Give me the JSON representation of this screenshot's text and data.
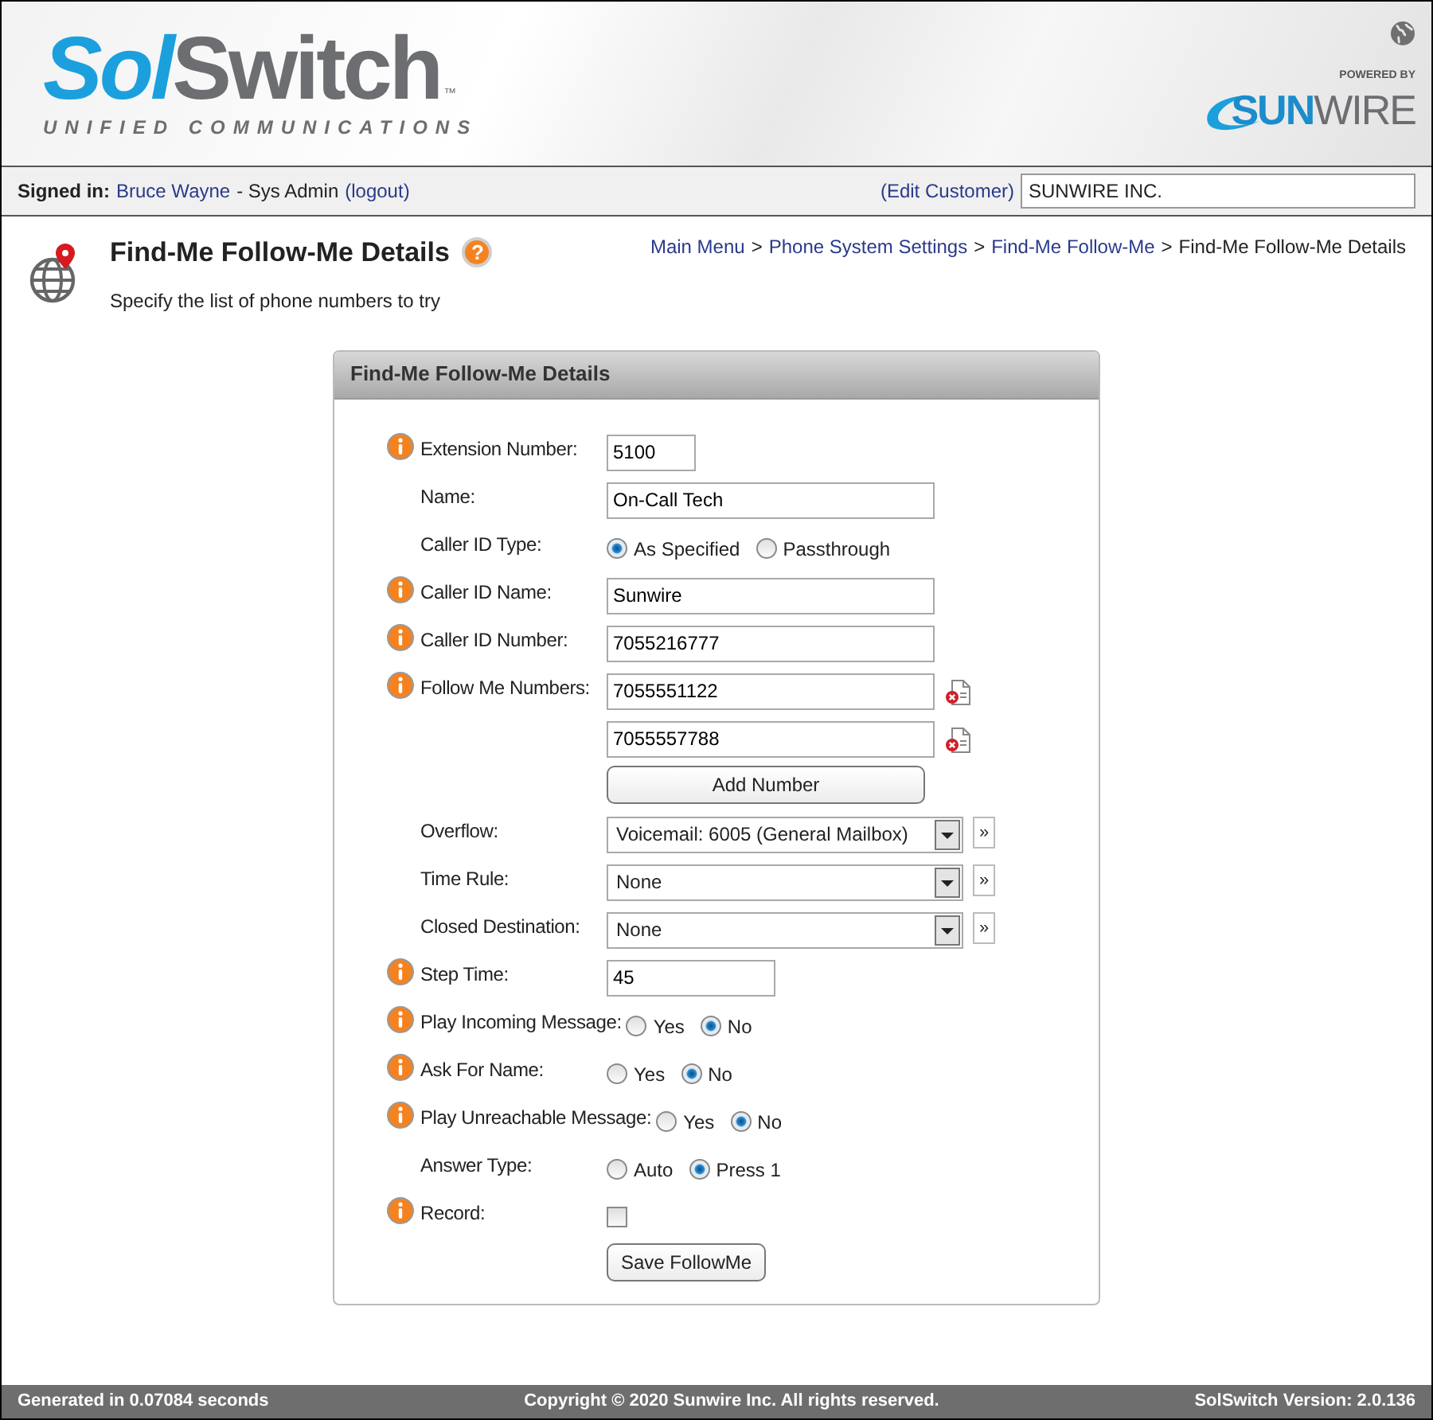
{
  "header": {
    "logo": {
      "part_1": "Sol",
      "part_2": "Switch",
      "trademark": "™",
      "tagline": "UNIFIED COMMUNICATIONS"
    },
    "partner_logo": {
      "caption": "POWERED BY",
      "part_1": "SUN",
      "part_2": "WIRE"
    }
  },
  "user_bar": {
    "label": "Signed in:",
    "user": "Bruce Wayne",
    "role": "- Sys Admin",
    "logout": "(logout)",
    "edit_customer": "(Edit Customer)",
    "customer_value": "SUNWIRE INC."
  },
  "page": {
    "title": "Find-Me Follow-Me Details",
    "help": "?",
    "subtitle": "Specify the list of phone numbers to try",
    "breadcrumb": [
      {
        "label": "Main Menu",
        "link": true
      },
      {
        "label": "Phone System Settings",
        "link": true
      },
      {
        "label": "Find-Me Follow-Me",
        "link": true
      },
      {
        "label": "Find-Me Follow-Me Details",
        "link": false
      }
    ],
    "separator": ">"
  },
  "panel": {
    "title": "Find-Me Follow-Me Details",
    "rows": [
      {
        "kind": "short_text",
        "label": "Extension Number:",
        "info": true,
        "values": [
          "5100"
        ]
      },
      {
        "kind": "text",
        "label": "Name:",
        "info": false,
        "values": [
          "On-Call Tech"
        ]
      },
      {
        "kind": "radio",
        "label": "Caller ID Type:",
        "info": false,
        "options": [
          {
            "label": "As Specified",
            "selected": true
          },
          {
            "label": "Passthrough",
            "selected": false
          }
        ]
      },
      {
        "kind": "text",
        "label": "Caller ID Name:",
        "info": true,
        "values": [
          "Sunwire"
        ]
      },
      {
        "kind": "text",
        "label": "Caller ID Number:",
        "info": true,
        "values": [
          "7055216777"
        ]
      },
      {
        "kind": "numbers",
        "label": "Follow Me Numbers:",
        "info": true,
        "values": [
          "7055551122",
          "7055557788"
        ]
      },
      {
        "kind": "button",
        "label": "Add Number"
      },
      {
        "kind": "select",
        "label": "Overflow:",
        "info": false,
        "value": "Voicemail: 6005 (General Mailbox)",
        "more": "»"
      },
      {
        "kind": "select",
        "label": "Time Rule:",
        "info": false,
        "value": "None",
        "more": "»"
      },
      {
        "kind": "select",
        "label": "Closed Destination:",
        "info": false,
        "value": "None",
        "more": "»"
      },
      {
        "kind": "medium_text",
        "label": "Step Time:",
        "info": true,
        "values": [
          "45"
        ]
      },
      {
        "kind": "radio",
        "label": "Play Incoming Message:",
        "info": true,
        "options": [
          {
            "label": "Yes",
            "selected": false
          },
          {
            "label": "No",
            "selected": true
          }
        ]
      },
      {
        "kind": "radio",
        "label": "Ask For Name:",
        "info": true,
        "options": [
          {
            "label": "Yes",
            "selected": false
          },
          {
            "label": "No",
            "selected": true
          }
        ]
      },
      {
        "kind": "radio",
        "label": "Play Unreachable Message:",
        "info": true,
        "options": [
          {
            "label": "Yes",
            "selected": false
          },
          {
            "label": "No",
            "selected": true
          }
        ]
      },
      {
        "kind": "radio",
        "label": "Answer Type:",
        "info": false,
        "options": [
          {
            "label": "Auto",
            "selected": false
          },
          {
            "label": "Press 1",
            "selected": true
          }
        ]
      },
      {
        "kind": "checkbox",
        "label": "Record:",
        "info": true,
        "checked": false
      },
      {
        "kind": "submit",
        "label": "Save FollowMe"
      }
    ]
  },
  "footer": {
    "generated": "Generated in 0.07084 seconds",
    "copyright": "Copyright © 2020 Sunwire Inc. All rights reserved.",
    "version": "SolSwitch Version: 2.0.136"
  }
}
